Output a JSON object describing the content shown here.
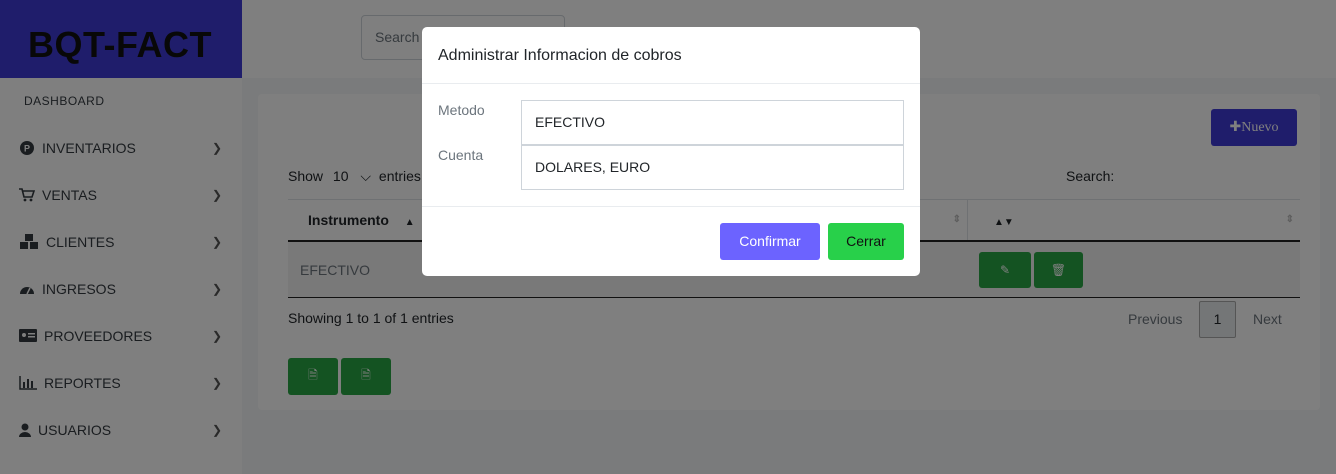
{
  "brand": "BQT-FACT",
  "sidebar": {
    "dashboard": "DASHBOARD",
    "items": [
      {
        "label": "INVENTARIOS",
        "icon": "parking-circle-icon"
      },
      {
        "label": "VENTAS",
        "icon": "cart-icon"
      },
      {
        "label": "CLIENTES",
        "icon": "cubes-icon"
      },
      {
        "label": "INGRESOS",
        "icon": "gauge-icon"
      },
      {
        "label": "PROVEEDORES",
        "icon": "id-card-icon"
      },
      {
        "label": "REPORTES",
        "icon": "bar-chart-icon"
      },
      {
        "label": "USUARIOS",
        "icon": "user-icon"
      }
    ]
  },
  "topbar": {
    "search_placeholder": "Search"
  },
  "main": {
    "new_button": "Nuevo",
    "show_label": "Show",
    "show_value": "10",
    "entries_label": "entries",
    "search_label": "Search:",
    "columns": [
      "Instrumento"
    ],
    "rows": [
      {
        "instrumento": "EFECTIVO"
      }
    ],
    "info": "Showing 1 to 1 of 1 entries",
    "pager": {
      "previous": "Previous",
      "page": "1",
      "next": "Next"
    }
  },
  "modal": {
    "title": "Administrar Informacion de cobros",
    "metodo_label": "Metodo",
    "metodo_value": "EFECTIVO",
    "cuenta_label": "Cuenta",
    "cuenta_value": "DOLARES, EURO",
    "confirm": "Confirmar",
    "close": "Cerrar"
  },
  "colors": {
    "brand": "#3f3ad6",
    "green": "#28a745",
    "confirm": "#6c63ff",
    "cerrar": "#28d04a"
  }
}
